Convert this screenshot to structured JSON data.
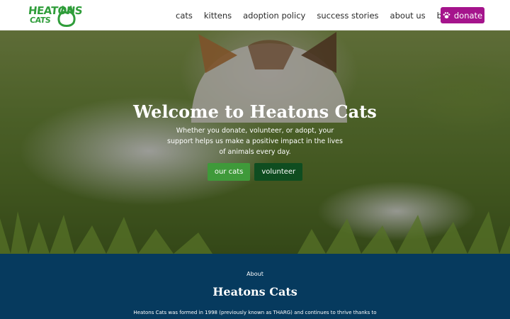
{
  "logo": {
    "line1": "HEATONS",
    "line2": "CATS"
  },
  "nav": {
    "items": [
      "cats",
      "kittens",
      "adoption policy",
      "success stories",
      "about us",
      "blog"
    ],
    "donate_label": "donate"
  },
  "hero": {
    "title": "Welcome to Heatons Cats",
    "subtitle": "Whether you donate, volunteer, or adopt, your support helps us make a positive impact in the lives of animals every day.",
    "primary_button": "our cats",
    "secondary_button": "volunteer"
  },
  "about": {
    "eyebrow": "About",
    "title": "Heatons Cats",
    "text": "Heatons Cats was formed in 1998 (previously known as THARG) and continues to thrive thanks to"
  },
  "colors": {
    "brand_green": "#2f9d3a",
    "donate_purple": "#a5148c",
    "about_bg": "#063a5e",
    "button_green": "#3f9a3a",
    "button_dark": "#0f4d20"
  },
  "icons": {
    "donate": "paw-icon",
    "logo": "cat-logo-icon"
  }
}
